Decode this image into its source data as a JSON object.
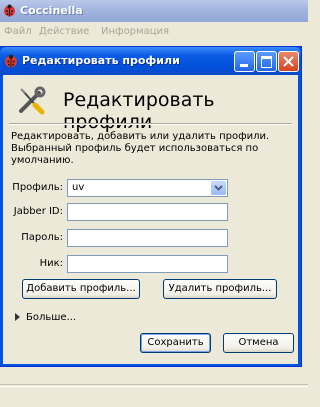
{
  "main_window": {
    "title": "Coccinella",
    "menu": [
      "Файл",
      "Действие",
      "Информация"
    ]
  },
  "dialog": {
    "title": "Редактировать профили",
    "heading": "Редактировать профили",
    "description": "Редактировать, добавить или удалить профили. Выбранный профиль будет использоваться по умолчанию.",
    "profile_label": "Профиль:",
    "profile_value": "uv",
    "jabber_label": "Jabber ID:",
    "jabber_value": "",
    "password_label": "Пароль:",
    "password_value": "",
    "nick_label": "Ник:",
    "nick_value": "",
    "add_button": "Добавить профиль...",
    "delete_button": "Удалить профиль...",
    "more_label": "Больше...",
    "save_button": "Сохранить",
    "cancel_button": "Отмена"
  },
  "colors": {
    "titlebar_blue": "#0a5ce5",
    "dialog_bg": "#ece9d8",
    "close_button": "#d3441f"
  },
  "icons": {
    "app": "ladybug-icon",
    "header": "wrench-screwdriver-icon",
    "dropdown": "chevron-down-icon",
    "more": "triangle-right-icon"
  }
}
